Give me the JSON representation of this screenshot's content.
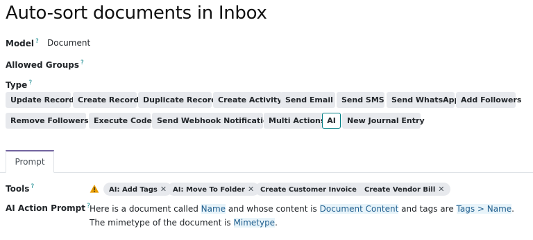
{
  "page": {
    "title": "Auto-sort documents in Inbox"
  },
  "fields": {
    "model": {
      "label": "Model",
      "help": "?",
      "value": "Document"
    },
    "allowed_groups": {
      "label": "Allowed Groups",
      "help": "?"
    },
    "type": {
      "label": "Type",
      "help": "?"
    },
    "tools": {
      "label": "Tools",
      "help": "?"
    },
    "ai_prompt": {
      "label": "AI Action Prompt",
      "help": "?"
    }
  },
  "type_options": [
    "Update Record",
    "Create Record",
    "Duplicate Record",
    "Create Activity",
    "Send Email",
    "Send SMS",
    "Send WhatsApp",
    "Add Followers",
    "Remove Followers",
    "Execute Code",
    "Send Webhook Notification",
    "Multi Actions",
    "AI",
    "New Journal Entry"
  ],
  "type_selected": "AI",
  "tabs": {
    "prompt": "Prompt"
  },
  "tools": {
    "warning_icon": "warning-icon",
    "tags": [
      "AI: Add Tags",
      "AI: Move To Folder",
      "Create Customer Invoice",
      "Create Vendor Bill"
    ],
    "remove_glyph": "✕"
  },
  "prompt": {
    "t1": "Here is a document called ",
    "h1": "Name",
    "t2": " and whose content is ",
    "h2": "Document Content",
    "t3": " and tags are ",
    "h3": "Tags > Name",
    "t4": ". The mimetype of the document is ",
    "h4": "Mimetype",
    "t5": "."
  },
  "colors": {
    "accent": "#017e84",
    "tab_accent": "#71639e",
    "button_bg": "#e7e9ed",
    "highlight_bg": "#e8f4fa",
    "warning": "#e99d00"
  }
}
